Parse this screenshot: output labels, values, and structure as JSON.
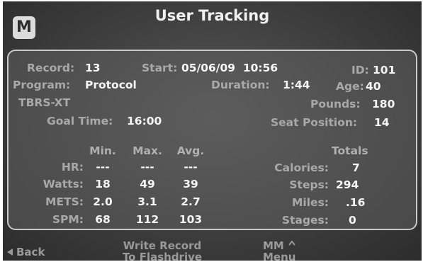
{
  "header": {
    "logo_letter": "M",
    "title": "User Tracking"
  },
  "record": {
    "record_label": "Record:",
    "record_value": "13",
    "start_label": "Start:",
    "start_value": "05/06/09  10:56",
    "id_label": "ID:",
    "id_value": "101",
    "program_label": "Program:",
    "program_value": "Protocol",
    "duration_label": "Duration:",
    "duration_value": "1:44",
    "age_label": "Age:",
    "age_value": "40",
    "program_line2": "TBRS-XT",
    "pounds_label": "Pounds:",
    "pounds_value": "180",
    "goal_label": "Goal Time:",
    "goal_value": "16:00",
    "seat_label": "Seat Position:",
    "seat_value": "14"
  },
  "stats": {
    "columns": [
      "Min.",
      "Max.",
      "Avg."
    ],
    "rows": [
      {
        "label": "HR:",
        "min": "---",
        "max": "---",
        "avg": "---"
      },
      {
        "label": "Watts:",
        "min": "18",
        "max": "49",
        "avg": "39"
      },
      {
        "label": "METS:",
        "min": "2.0",
        "max": "3.1",
        "avg": "2.7"
      },
      {
        "label": "SPM:",
        "min": "68",
        "max": "112",
        "avg": "103"
      }
    ]
  },
  "totals": {
    "header": "Totals",
    "rows": [
      {
        "label": "Calories:",
        "value": "7"
      },
      {
        "label": "Steps:",
        "value": "294"
      },
      {
        "label": "Miles:",
        "value": ".16"
      },
      {
        "label": "Stages:",
        "value": "0"
      }
    ]
  },
  "footer": {
    "back_label": "Back",
    "write_line1": "Write Record",
    "write_line2": "To Flashdrive",
    "mm_line1": "MM",
    "mm_line2": "Menu"
  },
  "icons": {
    "back": "triangle-left-icon",
    "mm": "caret-up-icon"
  }
}
